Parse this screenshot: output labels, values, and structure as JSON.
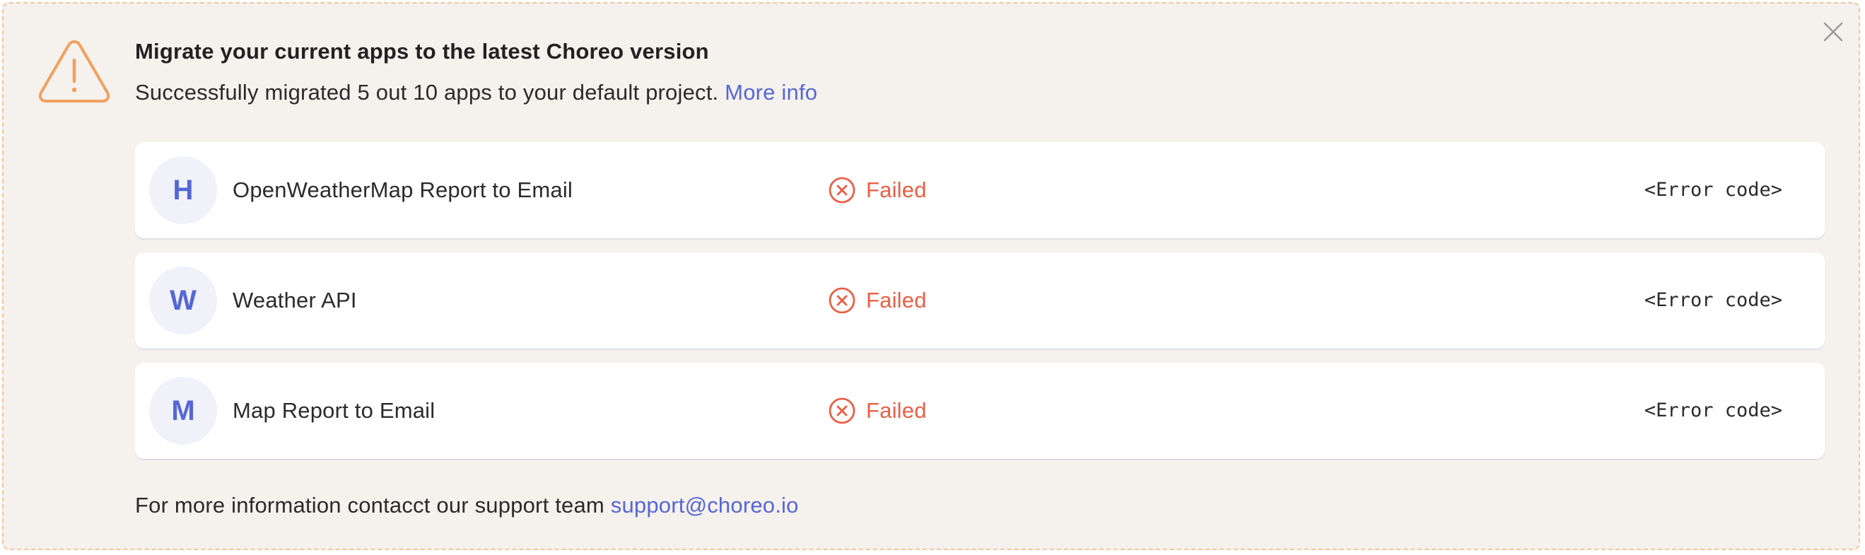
{
  "banner": {
    "title": "Migrate your current apps to the latest Choreo version",
    "description": "Successfully migrated 5 out 10 apps to your default project.",
    "more_info_link": "More info",
    "icons": {
      "warning": "warning-triangle-icon",
      "close": "close-icon"
    },
    "colors": {
      "background": "#f5f1ed",
      "border": "#f2c79c",
      "warning": "#f0a15e",
      "link": "#5567d5",
      "failed": "#ea5f45"
    }
  },
  "apps": [
    {
      "initial": "H",
      "name": "OpenWeatherMap Report to Email",
      "status": "Failed",
      "error_code": "<Error code>"
    },
    {
      "initial": "W",
      "name": "Weather API",
      "status": "Failed",
      "error_code": "<Error code>"
    },
    {
      "initial": "M",
      "name": "Map Report to Email",
      "status": "Failed",
      "error_code": "<Error code>"
    }
  ],
  "footer": {
    "text": "For more information contacct our support team",
    "email": "support@choreo.io"
  }
}
